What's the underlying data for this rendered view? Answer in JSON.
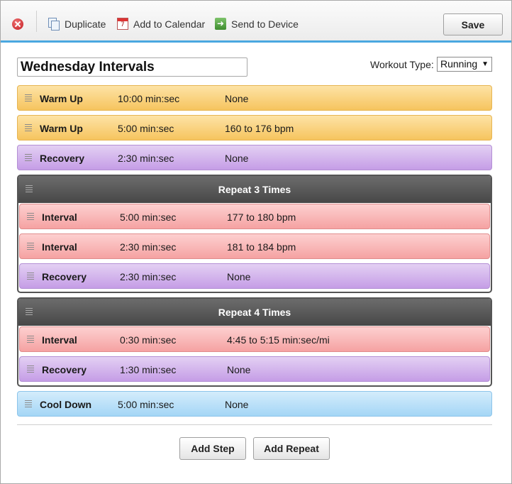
{
  "toolbar": {
    "close_icon": "close-circle-icon",
    "duplicate_label": "Duplicate",
    "add_calendar_label": "Add to Calendar",
    "send_device_label": "Send to Device",
    "save_label": "Save",
    "accent_color": "#4aa8e0"
  },
  "workout": {
    "name": "Wednesday Intervals",
    "type_label": "Workout Type:",
    "type_value": "Running"
  },
  "colors": {
    "warm_up": "#f6c45e",
    "recovery": "#c59de6",
    "interval": "#f5a2a2",
    "cool_down": "#a4d6f6",
    "repeat_header": "#555555"
  },
  "steps": [
    {
      "name": "Warm Up",
      "duration": "10:00 min:sec",
      "target": "None"
    },
    {
      "name": "Warm Up",
      "duration": "5:00 min:sec",
      "target": "160 to 176 bpm"
    },
    {
      "name": "Recovery",
      "duration": "2:30 min:sec",
      "target": "None"
    }
  ],
  "repeats": [
    {
      "title": "Repeat 3 Times",
      "steps": [
        {
          "name": "Interval",
          "duration": "5:00 min:sec",
          "target": "177 to 180 bpm"
        },
        {
          "name": "Interval",
          "duration": "2:30 min:sec",
          "target": "181 to 184 bpm"
        },
        {
          "name": "Recovery",
          "duration": "2:30 min:sec",
          "target": "None"
        }
      ]
    },
    {
      "title": "Repeat 4 Times",
      "steps": [
        {
          "name": "Interval",
          "duration": "0:30 min:sec",
          "target": "4:45 to 5:15 min:sec/mi"
        },
        {
          "name": "Recovery",
          "duration": "1:30 min:sec",
          "target": "None"
        }
      ]
    }
  ],
  "cool_down": {
    "name": "Cool Down",
    "duration": "5:00 min:sec",
    "target": "None"
  },
  "actions": {
    "add_step_label": "Add Step",
    "add_repeat_label": "Add Repeat"
  }
}
